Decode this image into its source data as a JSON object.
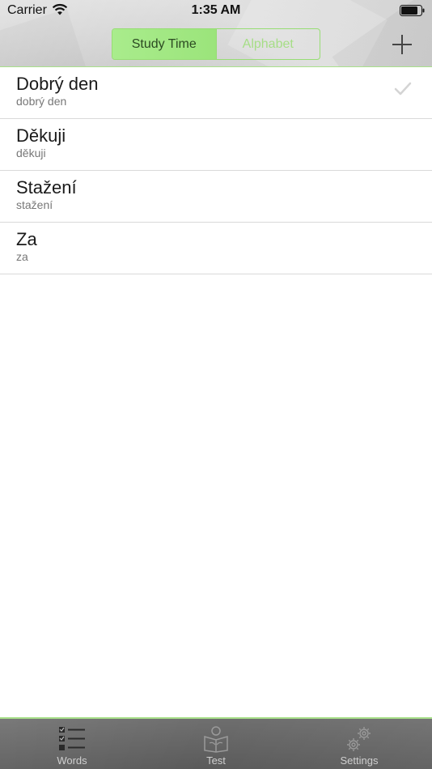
{
  "status_bar": {
    "carrier": "Carrier",
    "time": "1:35 AM"
  },
  "nav": {
    "segments": [
      {
        "label": "Study Time",
        "selected": true
      },
      {
        "label": "Alphabet",
        "selected": false
      }
    ],
    "add_icon": "plus-icon"
  },
  "words": [
    {
      "word": "Dobrý den",
      "pronunciation": "dobrý den",
      "checked": true
    },
    {
      "word": "Děkuji",
      "pronunciation": "děkuji",
      "checked": false
    },
    {
      "word": "Stažení",
      "pronunciation": "stažení",
      "checked": false
    },
    {
      "word": "Za",
      "pronunciation": "za",
      "checked": false
    }
  ],
  "tabbar": {
    "tabs": [
      {
        "label": "Words",
        "icon": "checklist-icon"
      },
      {
        "label": "Test",
        "icon": "reading-person-icon"
      },
      {
        "label": "Settings",
        "icon": "gears-icon"
      }
    ]
  },
  "colors": {
    "accent_green": "#a9ec8c",
    "segment_border": "#97dd74",
    "tabbar_bg": "#626262"
  }
}
